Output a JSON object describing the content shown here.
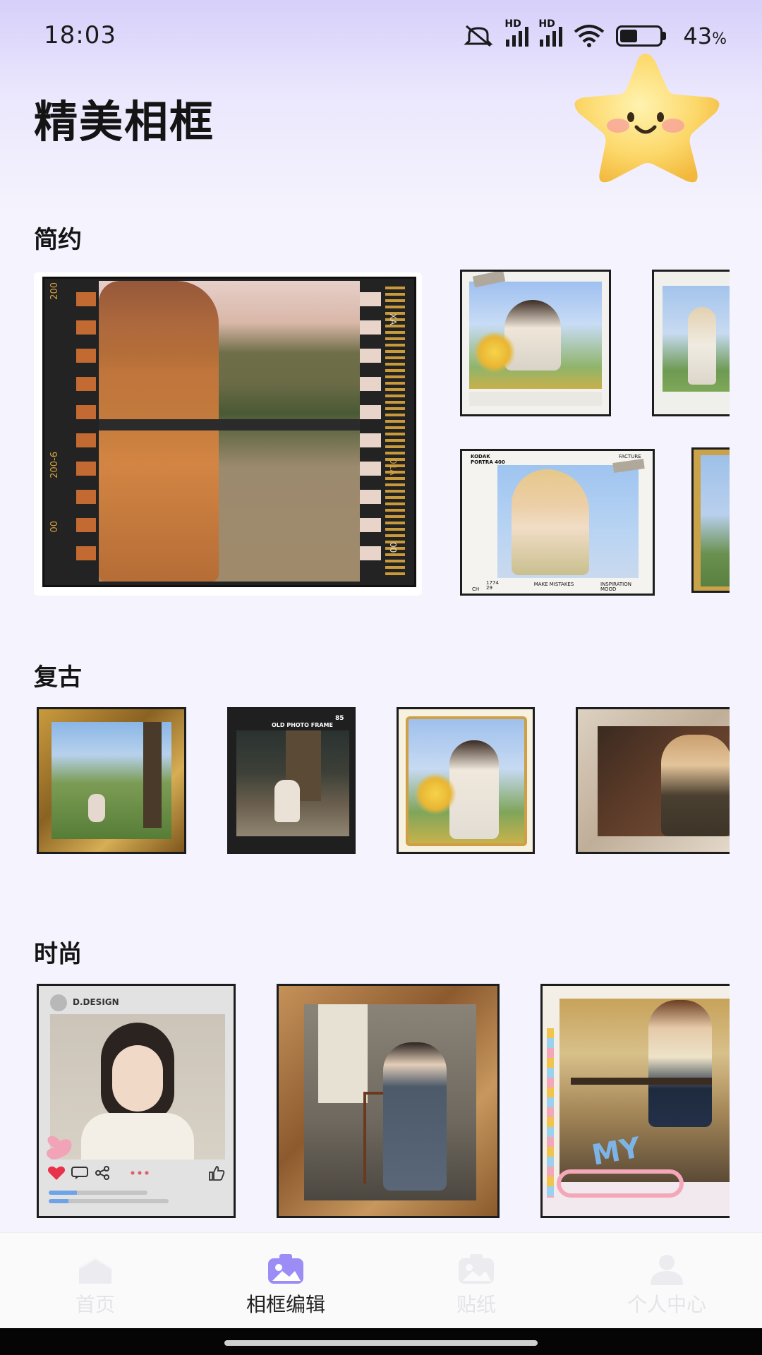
{
  "status_bar": {
    "time": "18:03",
    "hd_label": "HD",
    "battery_percent": 43,
    "battery_text": "43",
    "battery_unit": "%"
  },
  "page": {
    "title": "精美相框"
  },
  "sections": [
    {
      "title": "简约"
    },
    {
      "title": "复古"
    },
    {
      "title": "时尚"
    }
  ],
  "frame_texts": {
    "film_top": "200",
    "film_mid": "200-6",
    "film_bottom": "00",
    "film_right_top": "XA",
    "film_right_mid": "01A",
    "film_right_bottom": "00",
    "old_photo_num": "85",
    "old_photo_title": "OLD PHOTO FRAME",
    "poster_brand": "KODAK PORTRA 400",
    "poster_facture": "FACTURE",
    "poster_make": "MAKE MISTAKES",
    "poster_inspiration": "INSPIRATION MOOD",
    "poster_ch": "CH",
    "poster_num": "1774 29",
    "d_design": "D.DESIGN",
    "my_text": "MY"
  },
  "bottom_nav": {
    "items": [
      {
        "label": "首页",
        "icon": "home-icon",
        "active": false
      },
      {
        "label": "相框编辑",
        "icon": "frame-edit-icon",
        "active": true
      },
      {
        "label": "贴纸",
        "icon": "sticker-icon",
        "active": false
      },
      {
        "label": "个人中心",
        "icon": "profile-icon",
        "active": false
      }
    ]
  },
  "colors": {
    "accent": "#8f7df5",
    "background": "#f5f3fd",
    "title": "#141414"
  }
}
